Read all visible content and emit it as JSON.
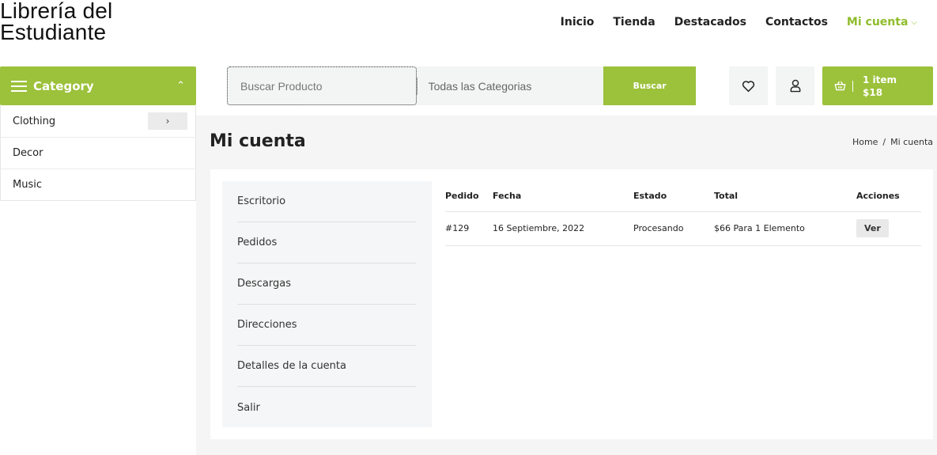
{
  "site": {
    "title": "Librería del Estudiante"
  },
  "nav": {
    "items": [
      {
        "label": "Inicio"
      },
      {
        "label": "Tienda"
      },
      {
        "label": "Destacados"
      },
      {
        "label": "Contactos"
      }
    ],
    "account": {
      "label": "Mi cuenta",
      "chevron": "⌵"
    }
  },
  "categories": {
    "title": "Category",
    "caret": "⌃",
    "items": [
      {
        "label": "Clothing",
        "arrow": "›"
      },
      {
        "label": "Decor"
      },
      {
        "label": "Music"
      }
    ]
  },
  "search": {
    "placeholder": "Buscar Producto",
    "category": "Todas las Categorias",
    "button": "Buscar"
  },
  "cart": {
    "items": "1 item",
    "total": "$18"
  },
  "icons": {
    "wishlist": "heart-icon",
    "user": "user-icon",
    "cart": "basket-icon",
    "menu": "hamburger-icon"
  },
  "colors": {
    "accent": "#9cc13b",
    "accent_text": "#8fbc2b"
  },
  "page": {
    "title": "Mi cuenta",
    "breadcrumb": {
      "home": "Home",
      "sep": "/",
      "current": "Mi cuenta"
    }
  },
  "account_nav": [
    {
      "label": "Escritorio"
    },
    {
      "label": "Pedidos"
    },
    {
      "label": "Descargas"
    },
    {
      "label": "Direcciones"
    },
    {
      "label": "Detalles de la cuenta"
    },
    {
      "label": "Salir"
    }
  ],
  "orders": {
    "headers": [
      "Pedido",
      "Fecha",
      "Estado",
      "Total",
      "Acciones"
    ],
    "rows": [
      {
        "order": "#129",
        "date": "16 Septiembre, 2022",
        "status": "Procesando",
        "total": "$66 Para 1 Elemento",
        "action": "Ver"
      }
    ]
  }
}
